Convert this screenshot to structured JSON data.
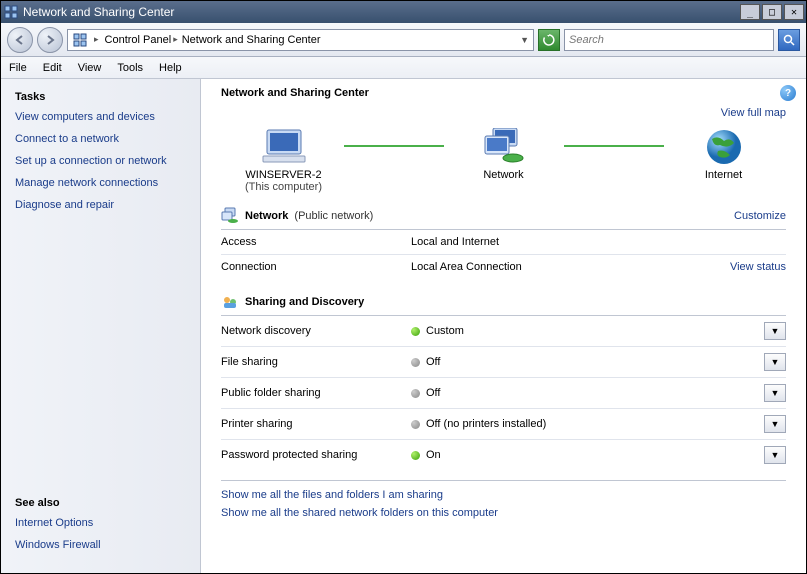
{
  "window": {
    "title": "Network and Sharing Center"
  },
  "breadcrumb": {
    "item1": "Control Panel",
    "item2": "Network and Sharing Center"
  },
  "search": {
    "placeholder": "Search"
  },
  "menu": {
    "file": "File",
    "edit": "Edit",
    "view": "View",
    "tools": "Tools",
    "help": "Help"
  },
  "sidebar": {
    "tasks_heading": "Tasks",
    "tasks": {
      "t0": "View computers and devices",
      "t1": "Connect to a network",
      "t2": "Set up a connection or network",
      "t3": "Manage network connections",
      "t4": "Diagnose and repair"
    },
    "seealso_heading": "See also",
    "seealso": {
      "s0": "Internet Options",
      "s1": "Windows Firewall"
    }
  },
  "main": {
    "heading": "Network and Sharing Center",
    "fullmap": "View full map",
    "nodes": {
      "computer": "WINSERVER-2",
      "computer_sub": "(This computer)",
      "network": "Network",
      "internet": "Internet"
    },
    "netsection": {
      "title": "Network",
      "subtitle": "(Public network)",
      "customize": "Customize",
      "access_label": "Access",
      "access_value": "Local and Internet",
      "conn_label": "Connection",
      "conn_value": "Local Area Connection",
      "viewstatus": "View status"
    },
    "sharing": {
      "title": "Sharing and Discovery",
      "rows": {
        "r0": {
          "label": "Network discovery",
          "value": "Custom",
          "on": true
        },
        "r1": {
          "label": "File sharing",
          "value": "Off",
          "on": false
        },
        "r2": {
          "label": "Public folder sharing",
          "value": "Off",
          "on": false
        },
        "r3": {
          "label": "Printer sharing",
          "value": "Off (no printers installed)",
          "on": false
        },
        "r4": {
          "label": "Password protected sharing",
          "value": "On",
          "on": true
        }
      }
    },
    "footer": {
      "f0": "Show me all the files and folders I am sharing",
      "f1": "Show me all the shared network folders on this computer"
    }
  }
}
